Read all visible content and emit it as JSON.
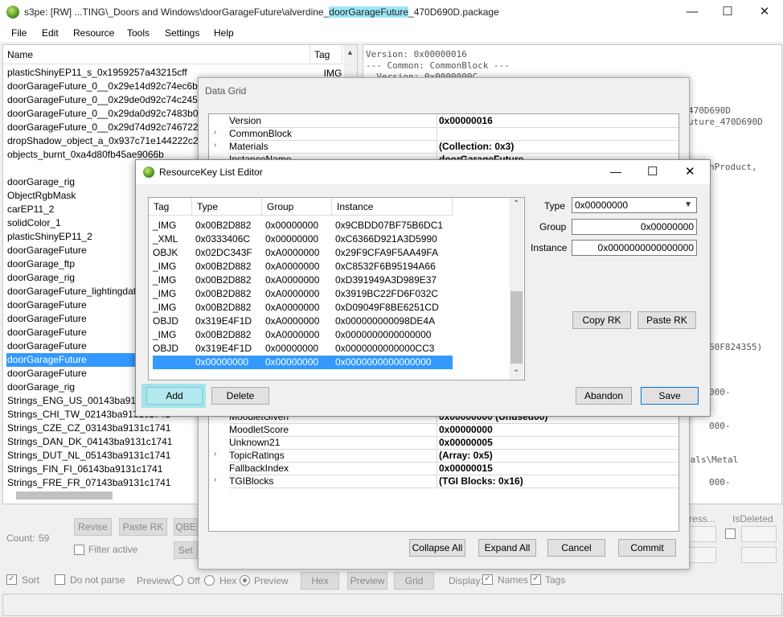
{
  "window": {
    "title_prefix": "s3pe: [RW] ...TING\\_Doors and Windows\\doorGarageFuture\\alverdine_",
    "title_highlight": "doorGarageFuture",
    "title_suffix": "_470D690D.package",
    "minimize": "—",
    "maximize": "☐",
    "close": "✕"
  },
  "menu": [
    "File",
    "Edit",
    "Resource",
    "Tools",
    "Settings",
    "Help"
  ],
  "resource_list": {
    "col_name": "Name",
    "col_tag": "Tag",
    "first_tag": "_IMG",
    "rows": [
      "plasticShinyEP11_s_0x1959257a43215cff",
      "doorGarageFuture_0__0x29e14d92c74ec6b4",
      "doorGarageFuture_0__0x29de0d92c74c245d",
      "doorGarageFuture_0__0x29da0d92c7483b02",
      "doorGarageFuture_0__0x29d74d92c746722b",
      "dropShadow_object_a_0x937c71e144222c2c",
      "objects_burnt_0xa4d80fb45ae9066b",
      "",
      "doorGarage_rig",
      "ObjectRgbMask",
      "carEP11_2",
      "solidColor_1",
      "plasticShinyEP11_2",
      "doorGarageFuture",
      "doorGarage_ftp",
      "doorGarage_rig",
      "doorGarageFuture_lightingdata",
      "doorGarageFuture",
      "doorGarageFuture",
      "doorGarageFuture",
      "doorGarageFuture",
      "doorGarageFuture",
      "doorGarageFuture",
      "doorGarage_rig",
      "Strings_ENG_US_00143ba9131c1741",
      "Strings_CHI_TW_02143ba9131c1741",
      "Strings_CZE_CZ_03143ba9131c1741",
      "Strings_DAN_DK_04143ba9131c1741",
      "Strings_DUT_NL_05143ba9131c1741",
      "Strings_FIN_FI_06143ba9131c1741",
      "Strings_FRE_FR_07143ba9131c1741"
    ],
    "selected_index": 21
  },
  "hex_lines": [
    "Version: 0x00000016",
    "--- Common: CommonBlock ---",
    "  Version: 0x0000000C",
    "470D690D",
    "uture_470D690D",
    "nProduct,",
    "60F824355)",
    "000-",
    "000-",
    "ials\\Metal",
    "000-"
  ],
  "bottom": {
    "count_label": "Count:",
    "count_value": "59",
    "revise": "Revise",
    "paste_rk": "Paste RK",
    "qbe": "QBE",
    "filter_active": "Filter active",
    "set": "Set",
    "sort": "Sort",
    "do_not_parse": "Do not parse",
    "preview_label": "Preview:",
    "off": "Off",
    "hex": "Hex",
    "preview": "Preview",
    "btn_hex": "Hex",
    "btn_preview": "Preview",
    "btn_grid": "Grid",
    "display_label": "Display:",
    "names": "Names",
    "tags": "Tags",
    "compress": "ress...",
    "is_deleted": "IsDeleted"
  },
  "data_grid": {
    "caption": "Data Grid",
    "rows_top": [
      {
        "arrow": "",
        "name": "Version",
        "value": "0x00000016"
      },
      {
        "arrow": "›",
        "name": "CommonBlock",
        "value": ""
      },
      {
        "arrow": "›",
        "name": "Materials",
        "value": "(Collection: 0x3)"
      },
      {
        "arrow": "",
        "name": "InstanceName",
        "value": "doorGarageFuture"
      }
    ],
    "rows_bottom": [
      {
        "arrow": "",
        "name": "MoodletGiven",
        "value": "0x00000000 (Unused00)"
      },
      {
        "arrow": "",
        "name": "MoodletScore",
        "value": "0x00000000"
      },
      {
        "arrow": "",
        "name": "Unknown21",
        "value": "0x00000005"
      },
      {
        "arrow": "›",
        "name": "TopicRatings",
        "value": "(Array: 0x5)"
      },
      {
        "arrow": "",
        "name": "FallbackIndex",
        "value": "0x00000015"
      },
      {
        "arrow": "›",
        "name": "TGIBlocks",
        "value": "(TGI Blocks: 0x16)"
      }
    ],
    "collapse_all": "Collapse All",
    "expand_all": "Expand All",
    "cancel": "Cancel",
    "commit": "Commit"
  },
  "rk_editor": {
    "title": "ResourceKey List Editor",
    "headers": {
      "tag": "Tag",
      "type": "Type",
      "group": "Group",
      "instance": "Instance"
    },
    "rows": [
      {
        "tag": "_IMG",
        "type": "0x00B2D882",
        "group": "0x00000000",
        "instance": "0x9CBDD07BF75B6DC1"
      },
      {
        "tag": "_XML",
        "type": "0x0333406C",
        "group": "0x00000000",
        "instance": "0xC6366D921A3D5990"
      },
      {
        "tag": "OBJK",
        "type": "0x02DC343F",
        "group": "0xA0000000",
        "instance": "0x29F9CFA9F5AA49FA"
      },
      {
        "tag": "_IMG",
        "type": "0x00B2D882",
        "group": "0xA0000000",
        "instance": "0xC8532F6B95194A66"
      },
      {
        "tag": "_IMG",
        "type": "0x00B2D882",
        "group": "0xA0000000",
        "instance": "0xD391949A3D989E37"
      },
      {
        "tag": "_IMG",
        "type": "0x00B2D882",
        "group": "0xA0000000",
        "instance": "0x3919BC22FD6F032C"
      },
      {
        "tag": "_IMG",
        "type": "0x00B2D882",
        "group": "0xA0000000",
        "instance": "0xD09049F8BE6251CD"
      },
      {
        "tag": "OBJD",
        "type": "0x319E4F1D",
        "group": "0xA0000000",
        "instance": "0x000000000098DE4A"
      },
      {
        "tag": "_IMG",
        "type": "0x00B2D882",
        "group": "0xA0000000",
        "instance": "0x0000000000000000"
      },
      {
        "tag": "OBJD",
        "type": "0x319E4F1D",
        "group": "0x00000000",
        "instance": "0x0000000000000CC3"
      },
      {
        "tag": "",
        "type": "0x00000000",
        "group": "0x00000000",
        "instance": "0x0000000000000000"
      }
    ],
    "selected_index": 10,
    "type_label": "Type",
    "type_value": "0x00000000",
    "group_label": "Group",
    "group_value": "0x00000000",
    "instance_label": "Instance",
    "instance_value": "0x0000000000000000",
    "copy_rk": "Copy RK",
    "paste_rk": "Paste RK",
    "add": "Add",
    "delete": "Delete",
    "abandon": "Abandon",
    "save": "Save"
  }
}
